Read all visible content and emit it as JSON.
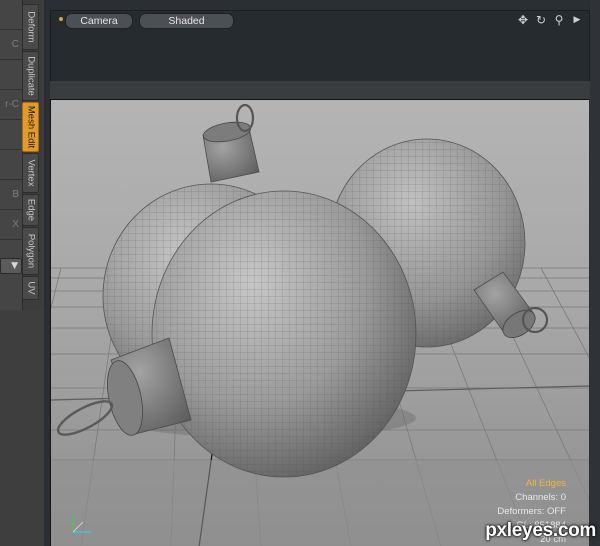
{
  "left_strip": {
    "letters": [
      "C",
      "r-C",
      "B",
      "X"
    ]
  },
  "vertical_tabs": [
    {
      "label": "Deform",
      "active": false
    },
    {
      "label": "Duplicate",
      "active": false
    },
    {
      "label": "Mesh Edit",
      "active": true
    },
    {
      "label": "Vertex",
      "active": false
    },
    {
      "label": "Edge",
      "active": false
    },
    {
      "label": "Polygon",
      "active": false
    },
    {
      "label": "UV",
      "active": false
    }
  ],
  "viewport": {
    "camera_label": "Camera",
    "shading_label": "Shaded",
    "icons": [
      "move-icon",
      "rotate-icon",
      "zoom-icon",
      "expand-arrow-icon"
    ],
    "accent_color": "#e39a2a"
  },
  "overlay": {
    "selection_mode": "All Edges",
    "channels": "Channels: 0",
    "deformers": "Deformers: OFF",
    "gl": "GL: 851884",
    "scale": "20 cm"
  },
  "watermark": "pxleyes.com"
}
